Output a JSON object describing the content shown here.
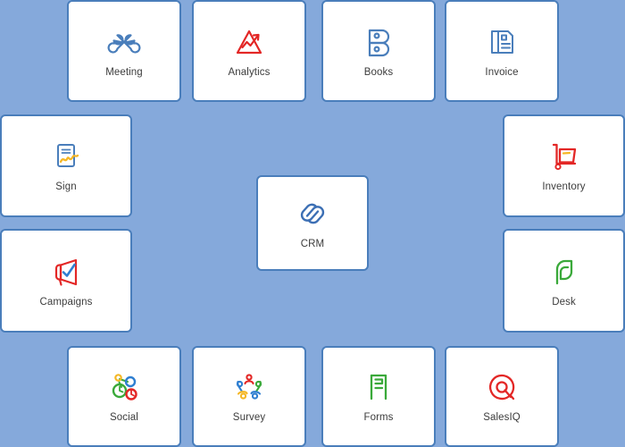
{
  "background_color": "#85a9db",
  "tile_border_color": "#4a7ebb",
  "tile_background_color": "#ffffff",
  "label_color": "#3c3c3c",
  "palette": {
    "blue": "#4a7ebb",
    "red": "#e32726",
    "green": "#3aa93a",
    "yellow": "#f5b725",
    "crm_blue": "#3c6fb4"
  },
  "center": {
    "label": "CRM",
    "icon": "crm-linked-rings-icon",
    "accent": "#3c6fb4"
  },
  "tiles": [
    {
      "id": "meeting",
      "label": "Meeting",
      "icon": "meeting-petals-icon",
      "accent": "#4a7ebb"
    },
    {
      "id": "analytics",
      "label": "Analytics",
      "icon": "analytics-peak-icon",
      "accent": "#e32726"
    },
    {
      "id": "books",
      "label": "Books",
      "icon": "books-b-icon",
      "accent": "#4a7ebb"
    },
    {
      "id": "invoice",
      "label": "Invoice",
      "icon": "invoice-document-icon",
      "accent": "#4a7ebb"
    },
    {
      "id": "sign",
      "label": "Sign",
      "icon": "sign-signature-icon",
      "accent": "#4a7ebb"
    },
    {
      "id": "campaigns",
      "label": "Campaigns",
      "icon": "campaigns-megaphone-icon",
      "accent": "#e32726"
    },
    {
      "id": "inventory",
      "label": "Inventory",
      "icon": "inventory-trolley-icon",
      "accent": "#e32726"
    },
    {
      "id": "desk",
      "label": "Desk",
      "icon": "desk-headset-icon",
      "accent": "#3aa93a"
    },
    {
      "id": "social",
      "label": "Social",
      "icon": "social-network-icon",
      "accent": "#3aa93a"
    },
    {
      "id": "survey",
      "label": "Survey",
      "icon": "survey-people-circle-icon",
      "accent": "#e32726"
    },
    {
      "id": "forms",
      "label": "Forms",
      "icon": "forms-page-icon",
      "accent": "#3aa93a"
    },
    {
      "id": "salesiq",
      "label": "SalesIQ",
      "icon": "salesiq-target-icon",
      "accent": "#e32726"
    }
  ]
}
